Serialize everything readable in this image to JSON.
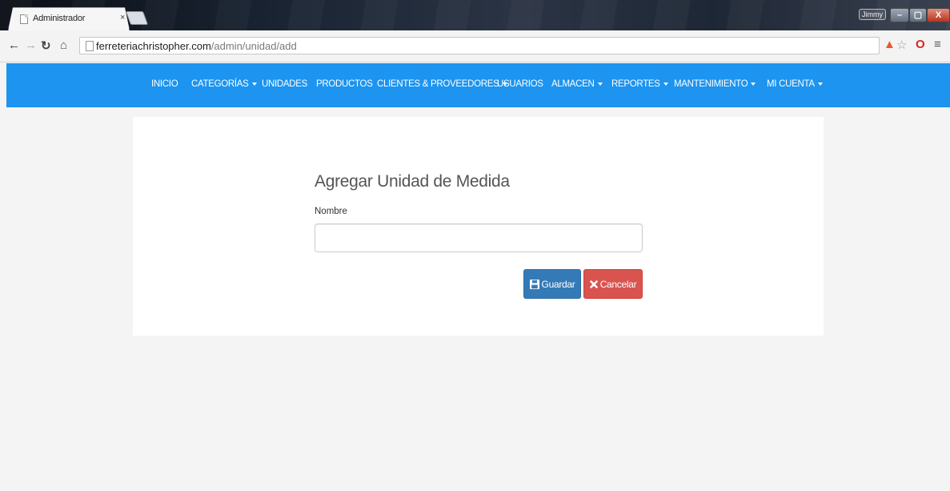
{
  "browser": {
    "tab_title": "Administrador",
    "tab_close": "×",
    "user_label": "Jimmy",
    "window_controls": {
      "minimize": "–",
      "maximize": "▢",
      "close": "X"
    },
    "url_host": "ferreteriachristopher.com",
    "url_path": "/admin/unidad/add",
    "icons": {
      "back": "back-arrow-icon",
      "forward": "forward-arrow-icon",
      "reload": "reload-icon",
      "home": "home-icon",
      "star": "bookmark-star-icon",
      "menu": "menu-icon"
    }
  },
  "navbar": {
    "background": "#1c94f0",
    "items": [
      {
        "label": "INICIO",
        "dropdown": false
      },
      {
        "label": "CATEGORÍAS",
        "dropdown": true
      },
      {
        "label": "UNIDADES",
        "dropdown": false
      },
      {
        "label": "PRODUCTOS",
        "dropdown": false
      },
      {
        "label": "CLIENTES & PROVEEDORES",
        "dropdown": true
      },
      {
        "label": "USUARIOS",
        "dropdown": false
      },
      {
        "label": "ALMACEN",
        "dropdown": true
      },
      {
        "label": "REPORTES",
        "dropdown": true
      },
      {
        "label": "MANTENIMIENTO",
        "dropdown": true
      },
      {
        "label": "MI CUENTA",
        "dropdown": true
      }
    ]
  },
  "form": {
    "title": "Agregar Unidad de Medida",
    "name_label": "Nombre",
    "name_value": "",
    "name_placeholder": "",
    "save_label": "Guardar",
    "cancel_label": "Cancelar",
    "save_color": "#337ab7",
    "cancel_color": "#d9534f"
  }
}
